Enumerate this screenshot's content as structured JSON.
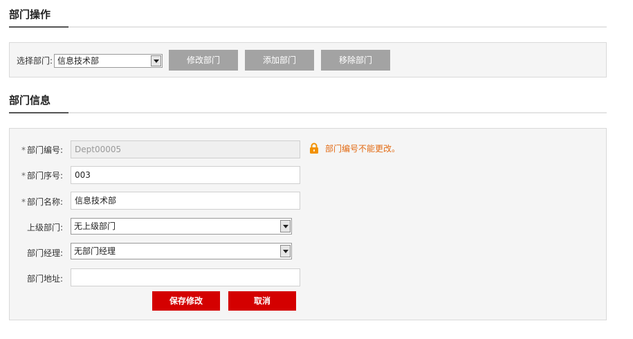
{
  "ops_section": {
    "title": "部门操作"
  },
  "ops_panel": {
    "select_label": "选择部门:",
    "selected_department": "信息技术部",
    "edit_button": "修改部门",
    "add_button": "添加部门",
    "delete_button": "移除部门"
  },
  "info_section": {
    "title": "部门信息"
  },
  "form": {
    "required_mark": "*",
    "dept_code_label": "部门编号:",
    "dept_code_value": "Dept00005",
    "dept_code_notice": "部门编号不能更改。",
    "dept_order_label": "部门序号:",
    "dept_order_value": "003",
    "dept_name_label": "部门名称:",
    "dept_name_value": "信息技术部",
    "parent_label": "上级部门:",
    "parent_value": "无上级部门",
    "manager_label": "部门经理:",
    "manager_value": "无部门经理",
    "address_label": "部门地址:",
    "address_value": "",
    "save_button": "保存修改",
    "cancel_button": "取消"
  },
  "colors": {
    "notice": "#e36b14",
    "primary_button": "#d40000",
    "disabled_button": "#a3a3a3",
    "lock_icon": "#f29100"
  }
}
